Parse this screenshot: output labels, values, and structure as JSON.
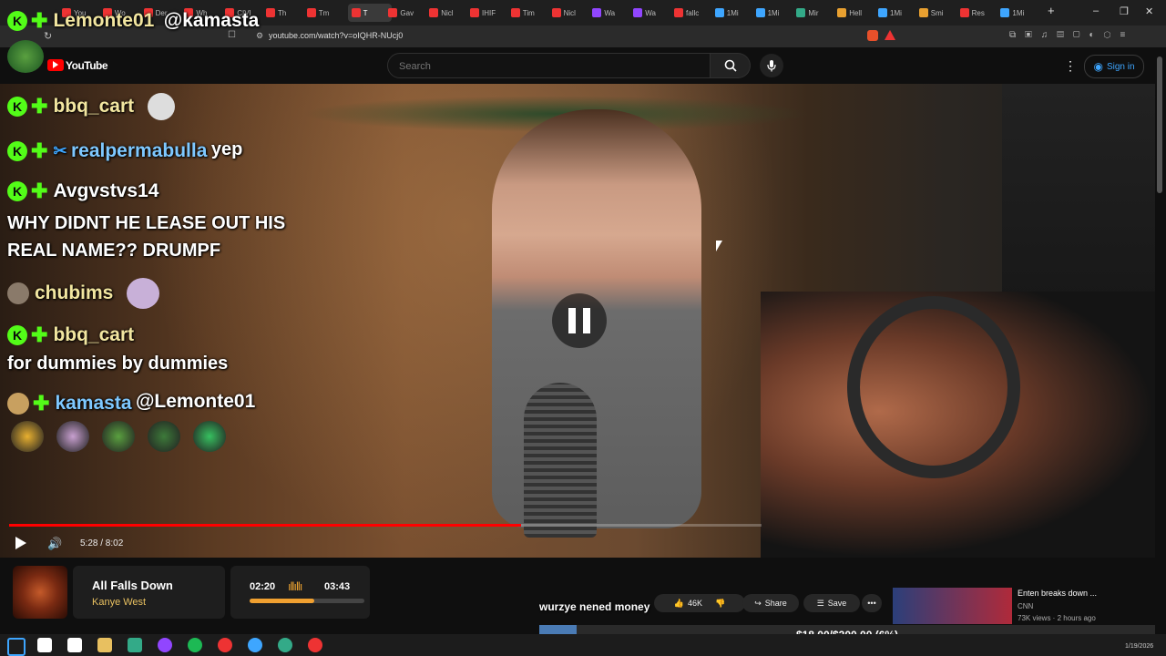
{
  "browser": {
    "tabs": [
      {
        "label": "You",
        "color": "#e33"
      },
      {
        "label": "Wo",
        "color": "#e33"
      },
      {
        "label": "Der",
        "color": "#e33"
      },
      {
        "label": "Wh",
        "color": "#e33"
      },
      {
        "label": "CIVI",
        "color": "#e33"
      },
      {
        "label": "Th",
        "color": "#e33"
      },
      {
        "label": "Tm",
        "color": "#e33"
      },
      {
        "label": "T",
        "color": "#e33",
        "active": true
      },
      {
        "label": "Gav",
        "color": "#e33"
      },
      {
        "label": "Nicl",
        "color": "#e33"
      },
      {
        "label": "IHIF",
        "color": "#e33"
      },
      {
        "label": "Tim",
        "color": "#e33"
      },
      {
        "label": "Nicl",
        "color": "#e33"
      },
      {
        "label": "Wa",
        "color": "#9146ff"
      },
      {
        "label": "Wa",
        "color": "#9146ff"
      },
      {
        "label": "fallc",
        "color": "#e33"
      },
      {
        "label": "1Mi",
        "color": "#3ea6ff"
      },
      {
        "label": "1Mi",
        "color": "#3ea6ff"
      },
      {
        "label": "Mir",
        "color": "#3a8"
      },
      {
        "label": "Hell",
        "color": "#e8a030"
      },
      {
        "label": "1Mi",
        "color": "#3ea6ff"
      },
      {
        "label": "Smi",
        "color": "#e8a030"
      },
      {
        "label": "Res",
        "color": "#e33"
      },
      {
        "label": "1Mi",
        "color": "#3ea6ff"
      }
    ],
    "url": "youtube.com/watch?v=oIQHR-NUcj0",
    "new_tab": "+",
    "window_controls": [
      "–",
      "❐",
      "✕"
    ]
  },
  "youtube": {
    "logo": "YouTube",
    "search_placeholder": "Search",
    "signin": "Sign in",
    "video_time": "5:28 / 8:02",
    "progress": 0.68,
    "actions": {
      "likes": "46K",
      "share": "Share",
      "save": "Save"
    },
    "recommended": {
      "title": "Enten breaks down ...",
      "channel": "CNN",
      "meta": "73K views · 2 hours ago"
    }
  },
  "overlay_header": {
    "name": "Lemonte01",
    "mention": "@kamasta"
  },
  "chat": [
    {
      "user": "bbq_cart",
      "color": "#f2e6a0",
      "message": "",
      "badges": [
        "K",
        "P"
      ],
      "emote": "ghost"
    },
    {
      "user": "realpermabulla",
      "color": "#7ec8ff",
      "message": "yep",
      "badges": [
        "K",
        "P"
      ],
      "emote": ""
    },
    {
      "user": "Avgvstvs14",
      "color": "#ffffff",
      "message": "WHY DIDNT HE LEASE OUT HIS REAL NAME?? DRUMPF",
      "badges": [
        "K",
        "P"
      ],
      "emote": ""
    },
    {
      "user": "chubims",
      "color": "#f2e6a0",
      "message": "",
      "badges": [
        "avatar"
      ],
      "emote": "anime"
    },
    {
      "user": "bbq_cart",
      "color": "#f2e6a0",
      "message": "for dummies by dummies",
      "badges": [
        "K",
        "P"
      ],
      "emote": ""
    },
    {
      "user": "kamasta",
      "color": "#7ec8ff",
      "message": "@Lemonte01",
      "badges": [
        "avatar",
        "P"
      ],
      "emote": ""
    }
  ],
  "emote_row": [
    "#e8b030",
    "#c8a0d0",
    "#5aa040",
    "#3d7a3a",
    "#37c060"
  ],
  "music": {
    "title": "All Falls Down",
    "artist": "Kanye West",
    "elapsed": "02:20",
    "total": "03:43",
    "progress": 0.56,
    "wave": "ıllıllı"
  },
  "donation_message": "wurzye nened money",
  "goal": {
    "text": "$18.00/$300.00 (6%)",
    "progress": 0.06
  },
  "taskbar_icons": [
    "#3ea6ff",
    "#ffffff",
    "#ffffff",
    "#e8c060",
    "#3a8",
    "#9146ff",
    "#1db954",
    "#e33",
    "#3ea6ff",
    "#3a8",
    "#e33"
  ],
  "clock": "1/19/2026"
}
